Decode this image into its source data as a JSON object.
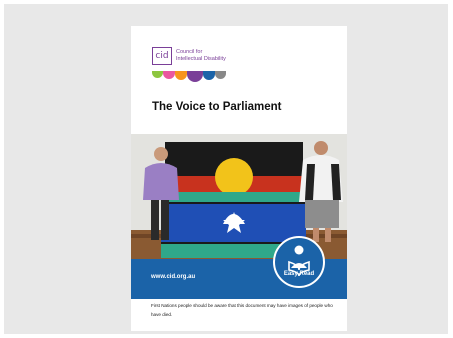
{
  "logo": {
    "mark": "cid",
    "org_line1": "Council for",
    "org_line2": "Intellectual Disability",
    "dot_colors": [
      "#8dc63f",
      "#e9579f",
      "#f7941d",
      "#7a3f98",
      "#1b63a8",
      "#888888"
    ]
  },
  "document": {
    "title": "The Voice to Parliament",
    "url": "www.cid.org.au",
    "badge_label": "Easy Read",
    "badge_icon": "reading-person-icon",
    "disclaimer": "First Nations people should be aware that this document may have images of people who have died."
  },
  "colors": {
    "brand_blue": "#1b63a8",
    "brand_purple": "#7a3f98"
  }
}
